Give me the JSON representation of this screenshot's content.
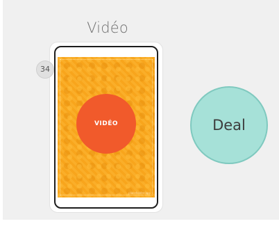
{
  "deck": {
    "title": "Vidéo",
    "count": "34",
    "card_label": "VIDÉO",
    "card_footer": "placeholder.app"
  },
  "actions": {
    "deal_label": "Deal"
  },
  "colors": {
    "card_background": "#f8a51c",
    "card_circle": "#f15a2b",
    "deal_button": "#a6e1d8",
    "panel_background": "#f0f0f0"
  }
}
